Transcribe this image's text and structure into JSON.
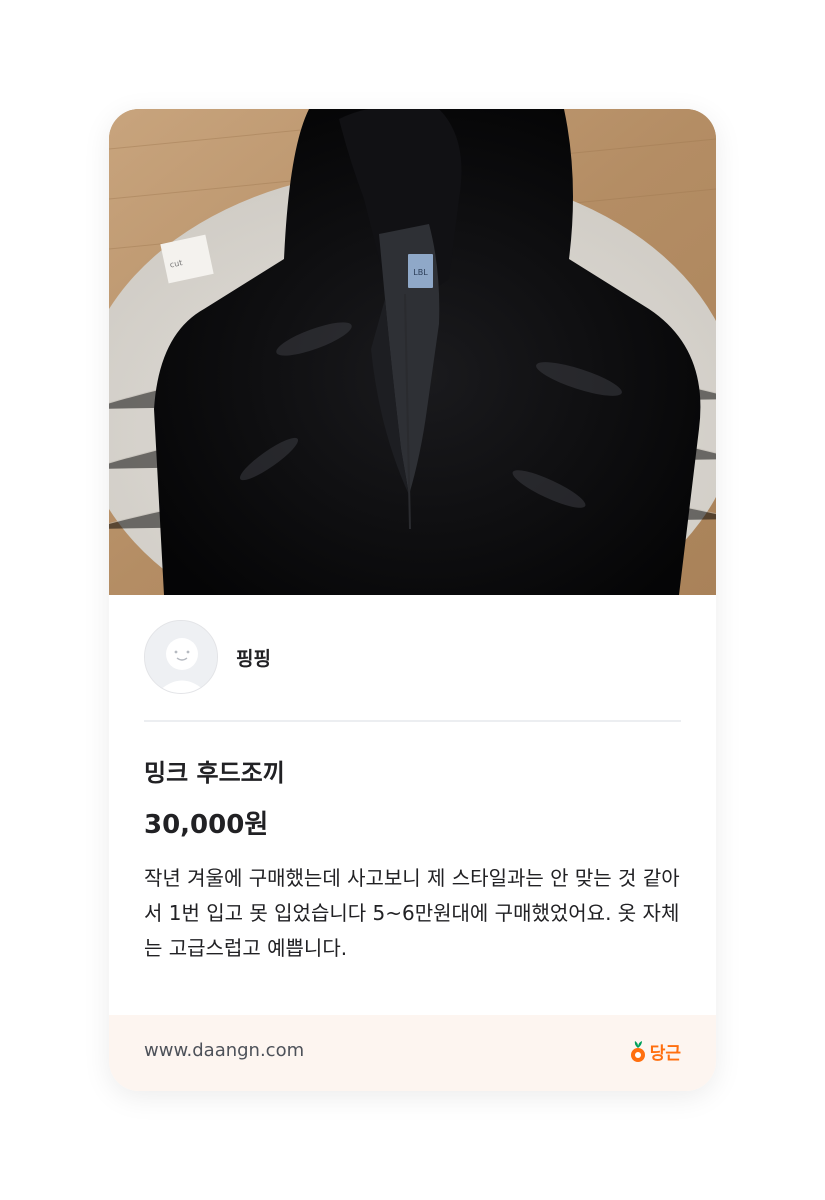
{
  "seller": {
    "nickname": "핑핑"
  },
  "product": {
    "title": "밍크 후드조끼",
    "price": "30,000원",
    "description": "작년 겨울에 구매했는데 사고보니 제 스타일과는 안 맞는 것 같아서 1번 입고 못 입었습니다 5~6만원대에 구매했었어요. 옷 자체는 고급스럽고 예쁩니다.",
    "image_label": "LBL"
  },
  "footer": {
    "site": "www.daangn.com",
    "brand": "당근"
  },
  "colors": {
    "brand": "#ff6f0f",
    "footer_bg": "#fdf5f0",
    "text": "#212124"
  },
  "icons": {
    "brand_logo": "carrot-icon",
    "avatar": "default-avatar-icon"
  }
}
